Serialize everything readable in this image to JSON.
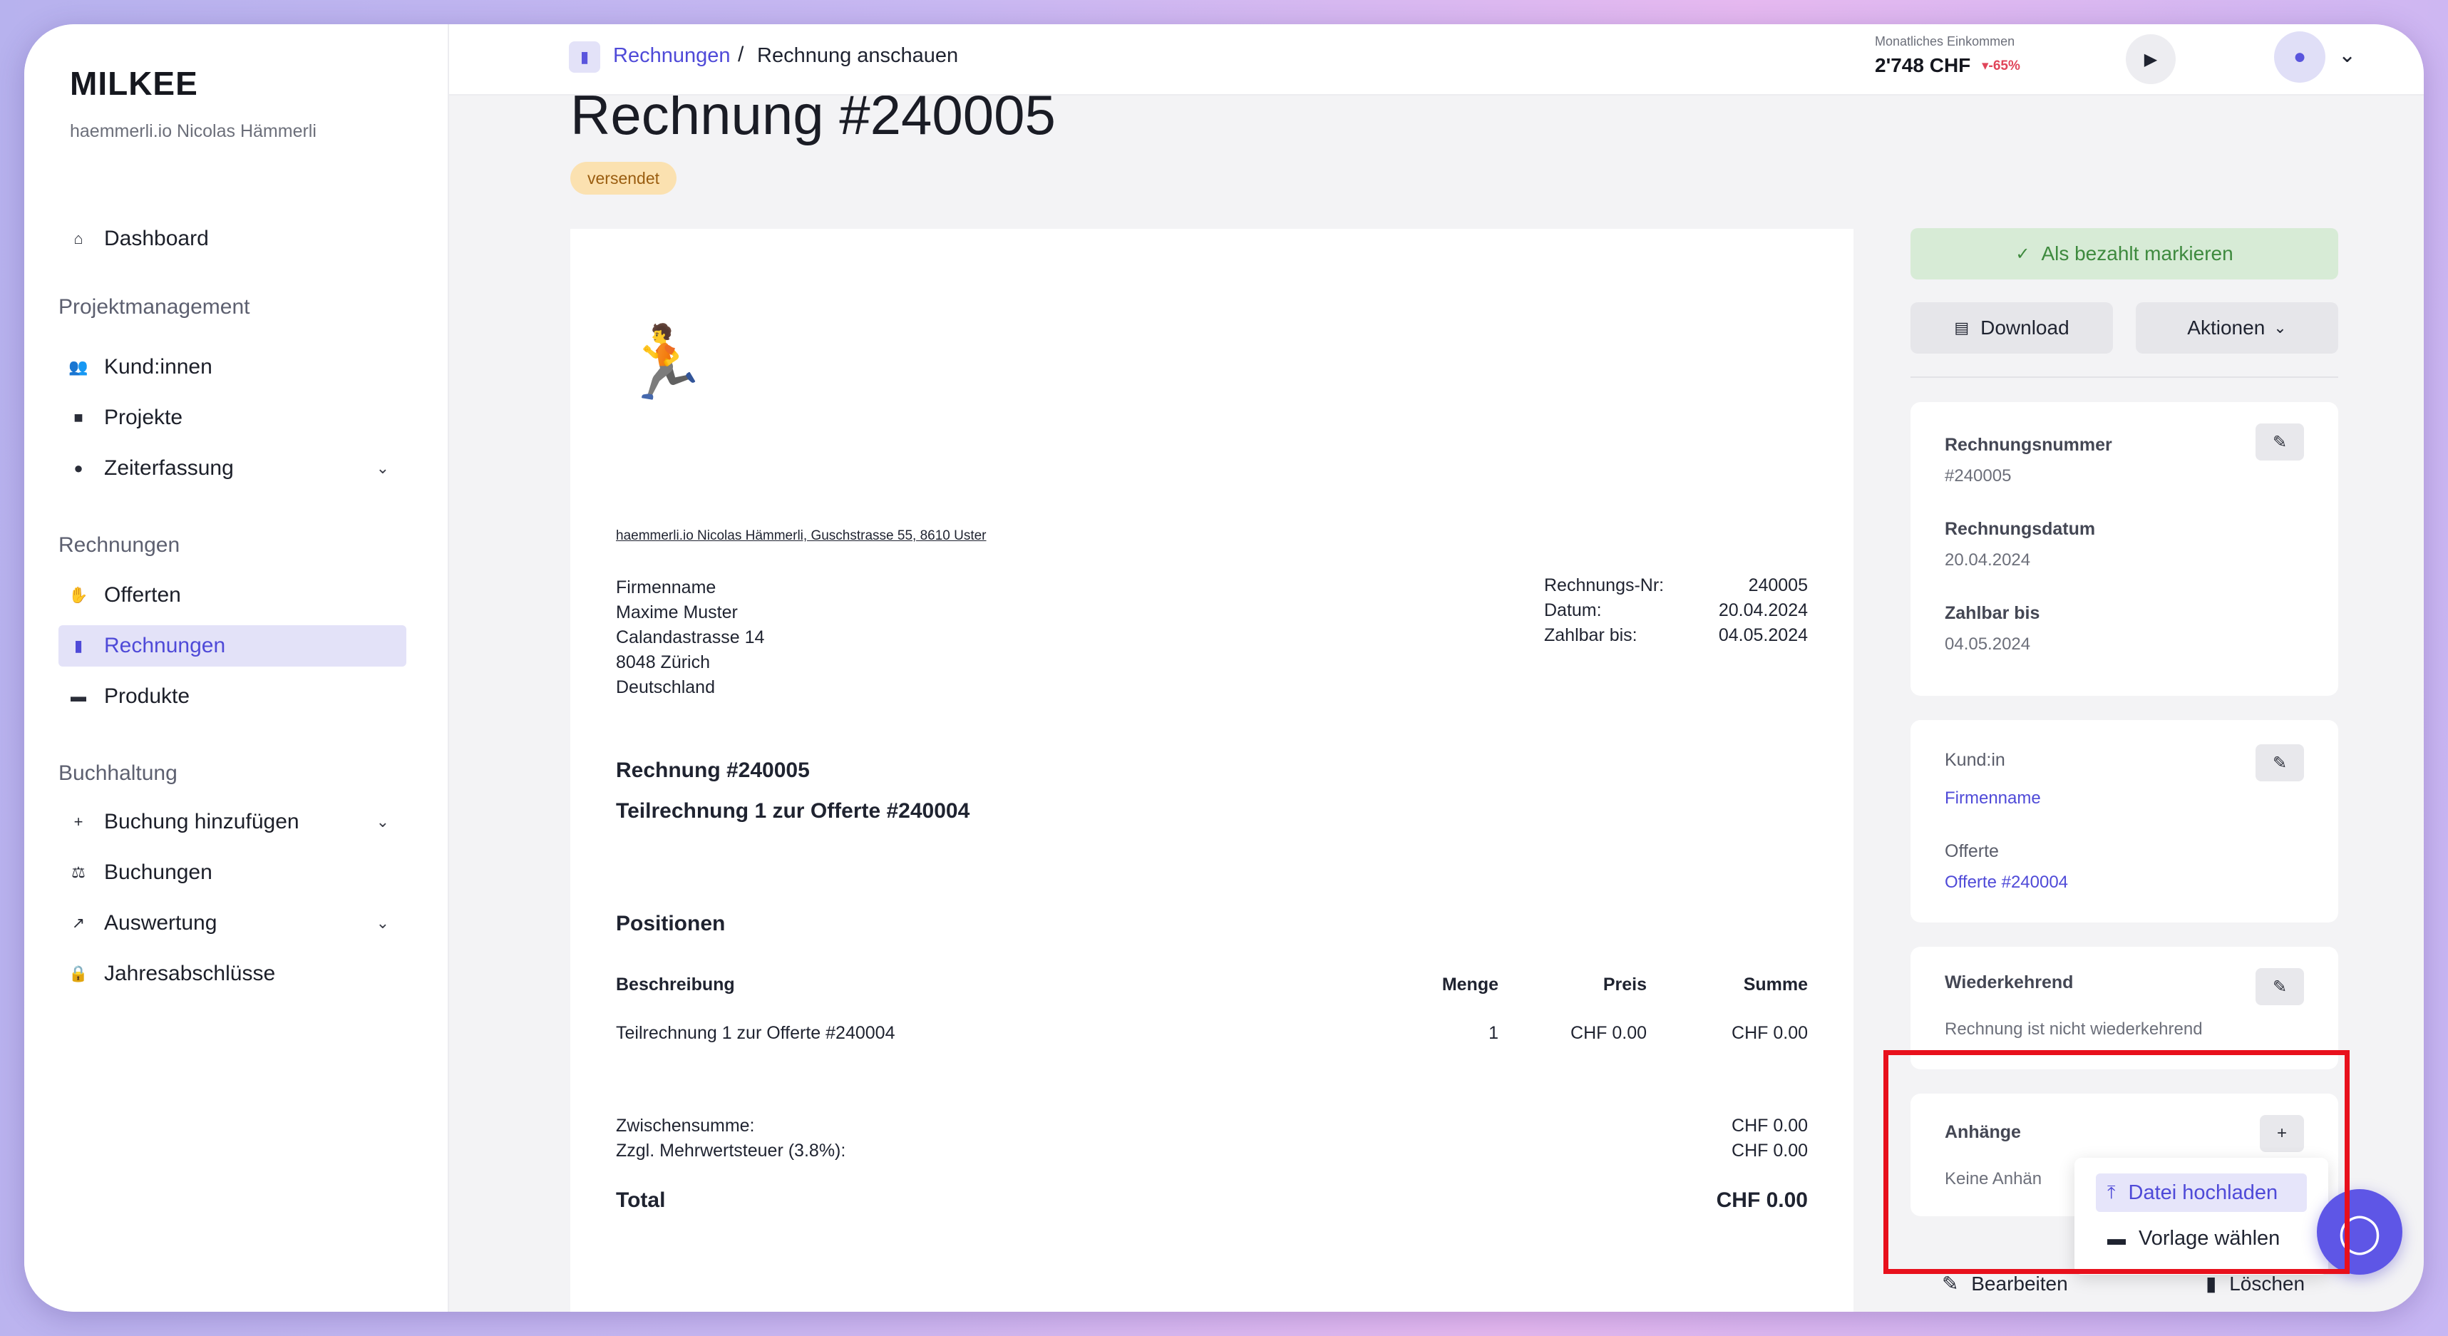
{
  "sidebar": {
    "brand": "MILKEE",
    "account": "haemmerli.io Nicolas Hämmerli",
    "items": [
      {
        "label": "Dashboard"
      },
      {
        "label": "Kund:innen"
      },
      {
        "label": "Projekte"
      },
      {
        "label": "Zeiterfassung"
      },
      {
        "label": "Offerten"
      },
      {
        "label": "Rechnungen"
      },
      {
        "label": "Produkte"
      },
      {
        "label": "Buchung hinzufügen"
      },
      {
        "label": "Buchungen"
      },
      {
        "label": "Auswertung"
      },
      {
        "label": "Jahresabschlüsse"
      }
    ],
    "sections": [
      "Projektmanagement",
      "Rechnungen",
      "Buchhaltung"
    ]
  },
  "topbar": {
    "breadcrumb_link": "Rechnungen",
    "breadcrumb_sep": "/",
    "breadcrumb_current": "Rechnung anschauen",
    "income_label": "Monatliches Einkommen",
    "income_value": "2'748 CHF",
    "income_delta": "▾-65%"
  },
  "page": {
    "title": "Rechnung #240005",
    "status": "versendet"
  },
  "invoice": {
    "logo": "🏃",
    "sender_line": "haemmerli.io Nicolas Hämmerli, Guschstrasse 55, 8610 Uster",
    "recipient": [
      "Firmenname",
      "Maxime Muster",
      "Calandastrasse 14",
      "8048 Zürich",
      "Deutschland"
    ],
    "meta": {
      "nr_label": "Rechnungs-Nr:",
      "nr_value": "240005",
      "date_label": "Datum:",
      "date_value": "20.04.2024",
      "due_label": "Zahlbar bis:",
      "due_value": "04.05.2024"
    },
    "heading": "Rechnung #240005",
    "subheading": "Teilrechnung 1 zur Offerte #240004",
    "positions_title": "Positionen",
    "columns": {
      "desc": "Beschreibung",
      "qty": "Menge",
      "price": "Preis",
      "sum": "Summe"
    },
    "rows": [
      {
        "desc": "Teilrechnung 1 zur Offerte #240004",
        "qty": "1",
        "price": "CHF 0.00",
        "sum": "CHF 0.00"
      }
    ],
    "subtotal_label": "Zwischensumme:",
    "subtotal_value": "CHF 0.00",
    "vat_label": "Zzgl. Mehrwertsteuer (3.8%):",
    "vat_value": "CHF 0.00",
    "total_label": "Total",
    "total_value": "CHF 0.00"
  },
  "actions": {
    "mark_paid": "Als bezahlt markieren",
    "download": "Download",
    "more": "Aktionen"
  },
  "details": {
    "invoice_number_label": "Rechnungsnummer",
    "invoice_number": "#240005",
    "invoice_date_label": "Rechnungsdatum",
    "invoice_date": "20.04.2024",
    "due_label": "Zahlbar bis",
    "due": "04.05.2024",
    "customer_label": "Kund:in",
    "customer": "Firmenname",
    "offer_label": "Offerte",
    "offer": "Offerte #240004",
    "recurring_label": "Wiederkehrend",
    "recurring_text": "Rechnung ist nicht wiederkehrend",
    "attachments_label": "Anhänge",
    "attachments_empty": "Keine Anhän"
  },
  "attach_menu": {
    "upload": "Datei hochladen",
    "template": "Vorlage wählen"
  },
  "bottom": {
    "edit": "Bearbeiten",
    "delete": "Löschen"
  },
  "colors": {
    "accent": "#4f4ad8",
    "highlight": "#e8101c",
    "paid_bg": "#d7ebd6",
    "badge_bg": "#fbe1b0"
  }
}
